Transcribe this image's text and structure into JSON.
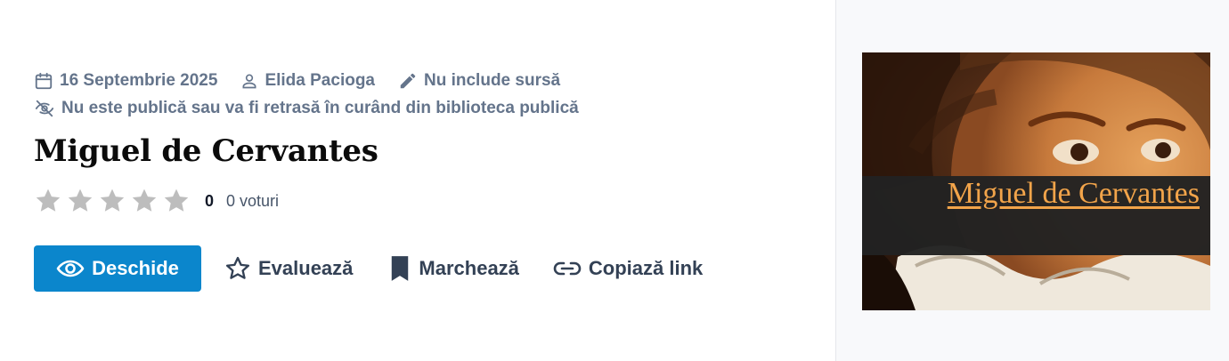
{
  "meta": {
    "date": "16 Septembrie 2025",
    "author": "Elida Pacioga",
    "source": "Nu include sursă",
    "visibility": "Nu este publică sau va fi retrasă în curând din biblioteca publică"
  },
  "title": "Miguel de Cervantes",
  "rating": {
    "stars_total": 5,
    "stars_filled": 0,
    "value": "0",
    "votes": "0 voturi"
  },
  "actions": {
    "open": "Deschide",
    "rate": "Evaluează",
    "bookmark": "Marchează",
    "copy_link": "Copiază link"
  },
  "cover": {
    "title": "Miguel de Cervantes"
  },
  "icons": {
    "date": "calendar-icon",
    "author": "user-icon",
    "source": "pencil-icon",
    "visibility": "eye-off-icon",
    "open": "eye-icon",
    "rate": "star-outline-icon",
    "bookmark": "bookmark-icon",
    "copy_link": "link-icon"
  },
  "colors": {
    "primary": "#0b86cc",
    "meta_text": "#64748b",
    "action_text": "#334155",
    "star_empty": "#bdbdbd",
    "cover_title": "#f2a44a",
    "aside_bg": "#f8f9fb"
  }
}
